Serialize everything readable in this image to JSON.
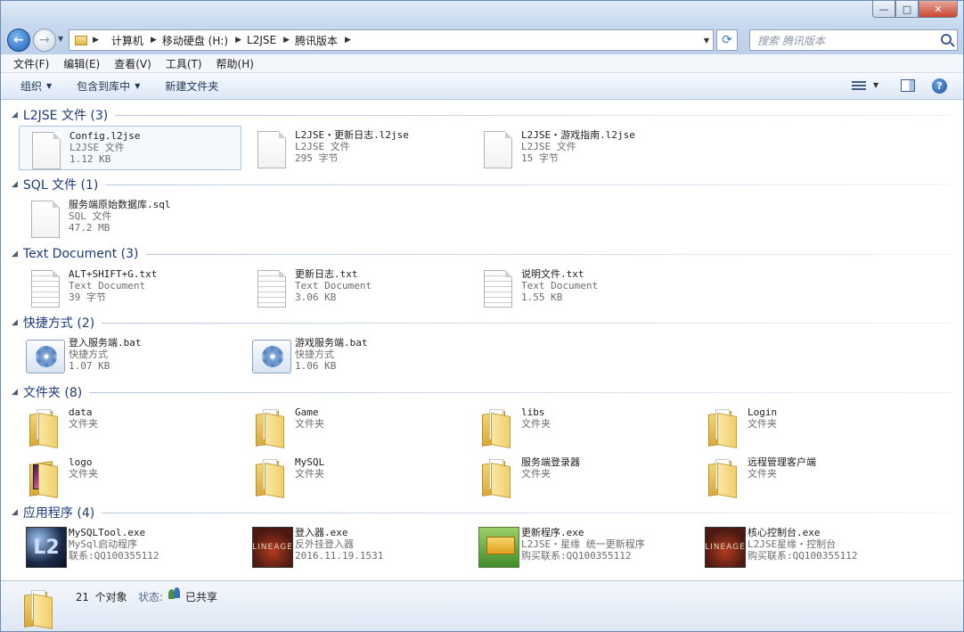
{
  "window": {
    "controls": {
      "minimize": "—",
      "maximize": "□",
      "close": "✕"
    }
  },
  "address": {
    "breadcrumbs": [
      "计算机",
      "移动硬盘 (H:)",
      "L2JSE",
      "腾讯版本"
    ],
    "search_placeholder": "搜索 腾讯版本"
  },
  "menu": [
    "文件(F)",
    "编辑(E)",
    "查看(V)",
    "工具(T)",
    "帮助(H)"
  ],
  "toolbar": {
    "organize": "组织",
    "include_library": "包含到库中",
    "new_folder": "新建文件夹"
  },
  "groups": [
    {
      "title": "L2JSE 文件 (3)",
      "items": [
        {
          "name": "Config.l2jse",
          "type": "L2JSE 文件",
          "info": "1.12 KB",
          "icon": "document-icon",
          "selected": true
        },
        {
          "name": "L2JSE・更新日志.l2jse",
          "type": "L2JSE 文件",
          "info": "295 字节",
          "icon": "document-icon"
        },
        {
          "name": "L2JSE・游戏指南.l2jse",
          "type": "L2JSE 文件",
          "info": "15 字节",
          "icon": "document-icon"
        }
      ]
    },
    {
      "title": "SQL 文件 (1)",
      "items": [
        {
          "name": "服务端原始数据库.sql",
          "type": "SQL 文件",
          "info": "47.2 MB",
          "icon": "document-icon"
        }
      ]
    },
    {
      "title": "Text Document (3)",
      "items": [
        {
          "name": "ALT+SHIFT+G.txt",
          "type": "Text Document",
          "info": "39 字节",
          "icon": "text-document-icon"
        },
        {
          "name": "更新日志.txt",
          "type": "Text Document",
          "info": "3.06 KB",
          "icon": "text-document-icon"
        },
        {
          "name": "说明文件.txt",
          "type": "Text Document",
          "info": "1.55 KB",
          "icon": "text-document-icon"
        }
      ]
    },
    {
      "title": "快捷方式 (2)",
      "items": [
        {
          "name": "登入服务端.bat",
          "type": "快捷方式",
          "info": "1.07 KB",
          "icon": "shortcut-icon"
        },
        {
          "name": "游戏服务端.bat",
          "type": "快捷方式",
          "info": "1.06 KB",
          "icon": "shortcut-icon"
        }
      ]
    },
    {
      "title": "文件夹 (8)",
      "items": [
        {
          "name": "data",
          "type": "文件夹",
          "icon": "folder-icon"
        },
        {
          "name": "Game",
          "type": "文件夹",
          "icon": "folder-icon"
        },
        {
          "name": "libs",
          "type": "文件夹",
          "icon": "folder-icon"
        },
        {
          "name": "Login",
          "type": "文件夹",
          "icon": "folder-icon"
        },
        {
          "name": "logo",
          "type": "文件夹",
          "icon": "picture-folder-icon"
        },
        {
          "name": "MySQL",
          "type": "文件夹",
          "icon": "folder-icon"
        },
        {
          "name": "服务端登录器",
          "type": "文件夹",
          "icon": "folder-icon"
        },
        {
          "name": "远程管理客户端",
          "type": "文件夹",
          "icon": "folder-icon"
        }
      ]
    },
    {
      "title": "应用程序 (4)",
      "items": [
        {
          "name": "MySQLTool.exe",
          "type": "MySql启动程序",
          "info": "联系:QQ100355112",
          "icon": "l2-app-icon"
        },
        {
          "name": "登入器.exe",
          "type": "反外挂登入器",
          "info": "2016.11.19.1531",
          "icon": "lineage-app-icon"
        },
        {
          "name": "更新程序.exe",
          "type": "L2JSE・星缘 统一更新程序",
          "info": "购买联系:QQ100355112",
          "icon": "updater-app-icon"
        },
        {
          "name": "核心控制台.exe",
          "type": "L2JSE星缘・控制台",
          "info": "购买联系:QQ100355112",
          "icon": "lineage-app-icon"
        }
      ]
    }
  ],
  "details": {
    "count": "21 个对象",
    "state_label": "状态:",
    "state_value": "已共享"
  }
}
